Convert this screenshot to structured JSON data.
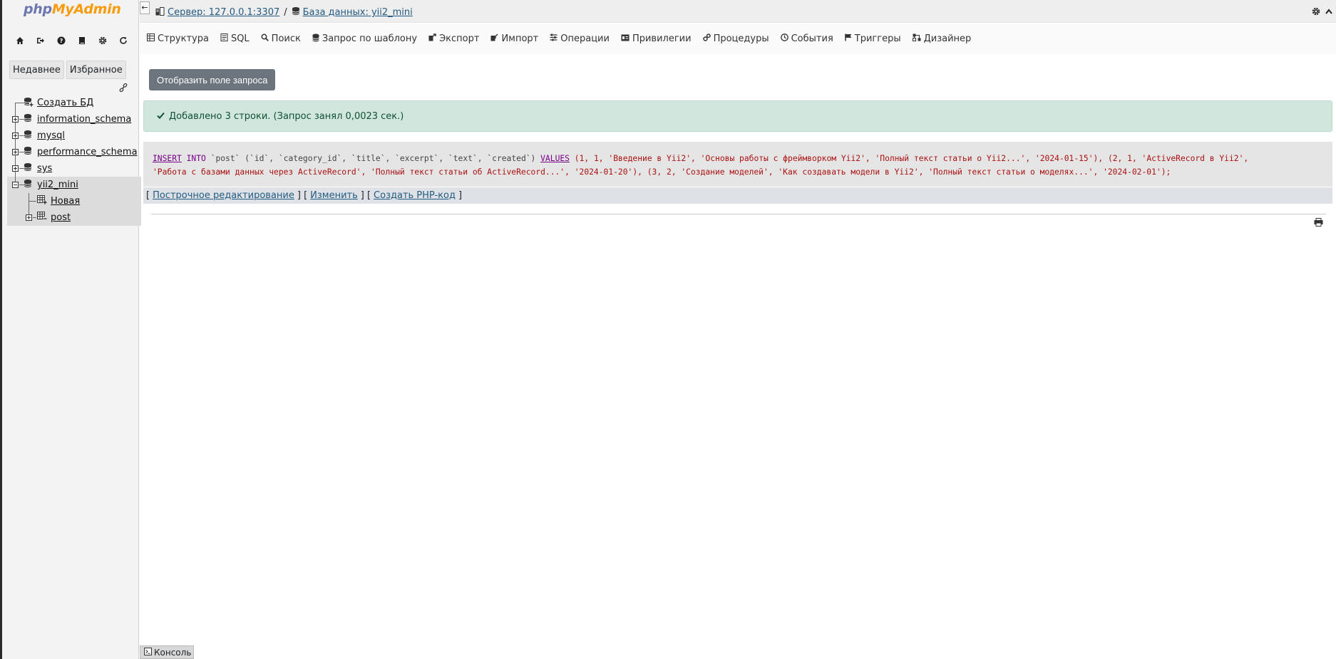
{
  "logo": {
    "part1": "php",
    "part2": "MyAdmin"
  },
  "sidebar": {
    "nav_icons": [
      "home-icon",
      "logout-icon",
      "help-icon",
      "docs-icon",
      "settings-icon",
      "reload-icon"
    ],
    "recent_label": "Недавнее",
    "favorites_label": "Избранное",
    "create_db_label": "Создать БД",
    "databases": [
      {
        "name": "information_schema"
      },
      {
        "name": "mysql"
      },
      {
        "name": "performance_schema"
      },
      {
        "name": "sys"
      },
      {
        "name": "yii2_mini",
        "selected": true
      }
    ],
    "tables": {
      "new_label": "Новая",
      "post": "post"
    }
  },
  "breadcrumb": {
    "server": "Сервер: 127.0.0.1:3307",
    "sep": "/",
    "database": "База данных: yii2_mini"
  },
  "menu": [
    {
      "label": "Структура",
      "icon": "structure-icon"
    },
    {
      "label": "SQL",
      "icon": "sql-icon"
    },
    {
      "label": "Поиск",
      "icon": "search-icon"
    },
    {
      "label": "Запрос по шаблону",
      "icon": "query-icon"
    },
    {
      "label": "Экспорт",
      "icon": "export-icon"
    },
    {
      "label": "Импорт",
      "icon": "import-icon"
    },
    {
      "label": "Операции",
      "icon": "operations-icon"
    },
    {
      "label": "Привилегии",
      "icon": "privileges-icon"
    },
    {
      "label": "Процедуры",
      "icon": "routines-icon"
    },
    {
      "label": "События",
      "icon": "events-icon"
    },
    {
      "label": "Триггеры",
      "icon": "triggers-icon"
    },
    {
      "label": "Дизайнер",
      "icon": "designer-icon"
    }
  ],
  "main": {
    "show_query_button": "Отобразить поле запроса",
    "success_message": "Добавлено 3 строки. (Запрос занял 0,0023 сек.)",
    "sql": {
      "insert": "INSERT",
      "into": "INTO",
      "table": "`post`",
      "columns": "(`id`, `category_id`, `title`, `excerpt`, `text`, `created`)",
      "values_kw": "VALUES",
      "row1": "(1, 1, 'Введение в Yii2', 'Основы работы с фреймворком Yii2', 'Полный текст статьи о Yii2...', '2024-01-15'),",
      "row2a": "(2, 1, 'ActiveRecord в Yii2',",
      "row2b": "'Работа с базами данных через ActiveRecord', 'Полный текст статьи об ActiveRecord...', '2024-01-20'),",
      "row3": "(3, 2, 'Создание моделей', 'Как создавать модели в Yii2', 'Полный текст статьи о моделях...', '2024-02-01');"
    },
    "tools": {
      "inline_edit": "Построчное редактирование",
      "edit": "Изменить",
      "create_php": "Создать PHP-код"
    }
  },
  "console_label": "Консоль",
  "colors": {
    "accent": "#235a81",
    "success_bg": "#d1e7dd",
    "button_bg": "#6c757d"
  }
}
